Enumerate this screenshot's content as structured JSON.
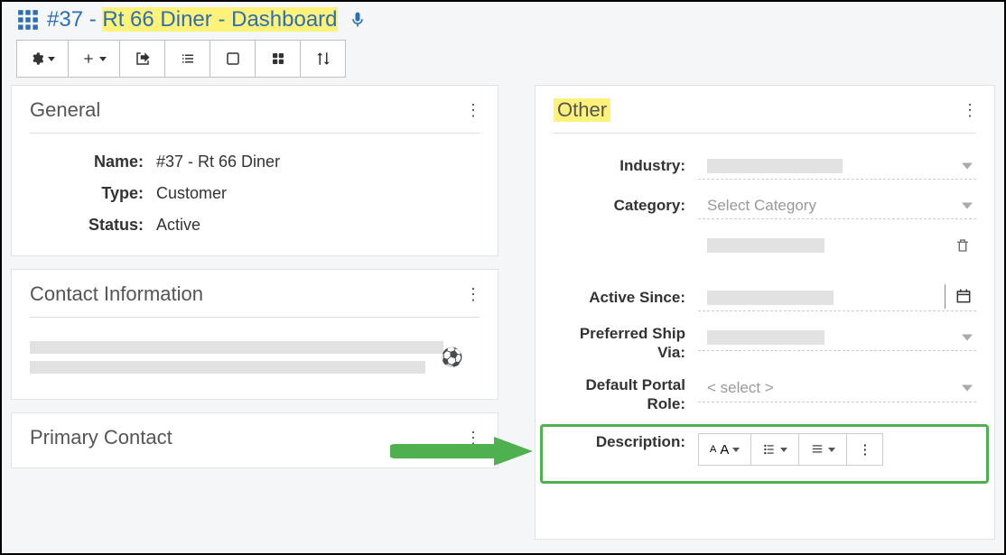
{
  "header": {
    "record_number": "#37",
    "record_name": "Rt 66 Diner",
    "section": "Dashboard"
  },
  "panels": {
    "general": {
      "title": "General",
      "name_label": "Name:",
      "name_value": "#37 - Rt 66 Diner",
      "type_label": "Type:",
      "type_value": "Customer",
      "status_label": "Status:",
      "status_value": "Active"
    },
    "contact_info": {
      "title": "Contact Information"
    },
    "primary_contact": {
      "title": "Primary Contact"
    },
    "other": {
      "title": "Other",
      "fields": {
        "industry_label": "Industry:",
        "category_label": "Category:",
        "category_placeholder": "Select Category",
        "active_since_label": "Active Since:",
        "ship_via_label": "Preferred Ship Via:",
        "portal_role_label": "Default Portal Role:",
        "portal_role_placeholder": "< select >",
        "description_label": "Description:"
      }
    }
  }
}
